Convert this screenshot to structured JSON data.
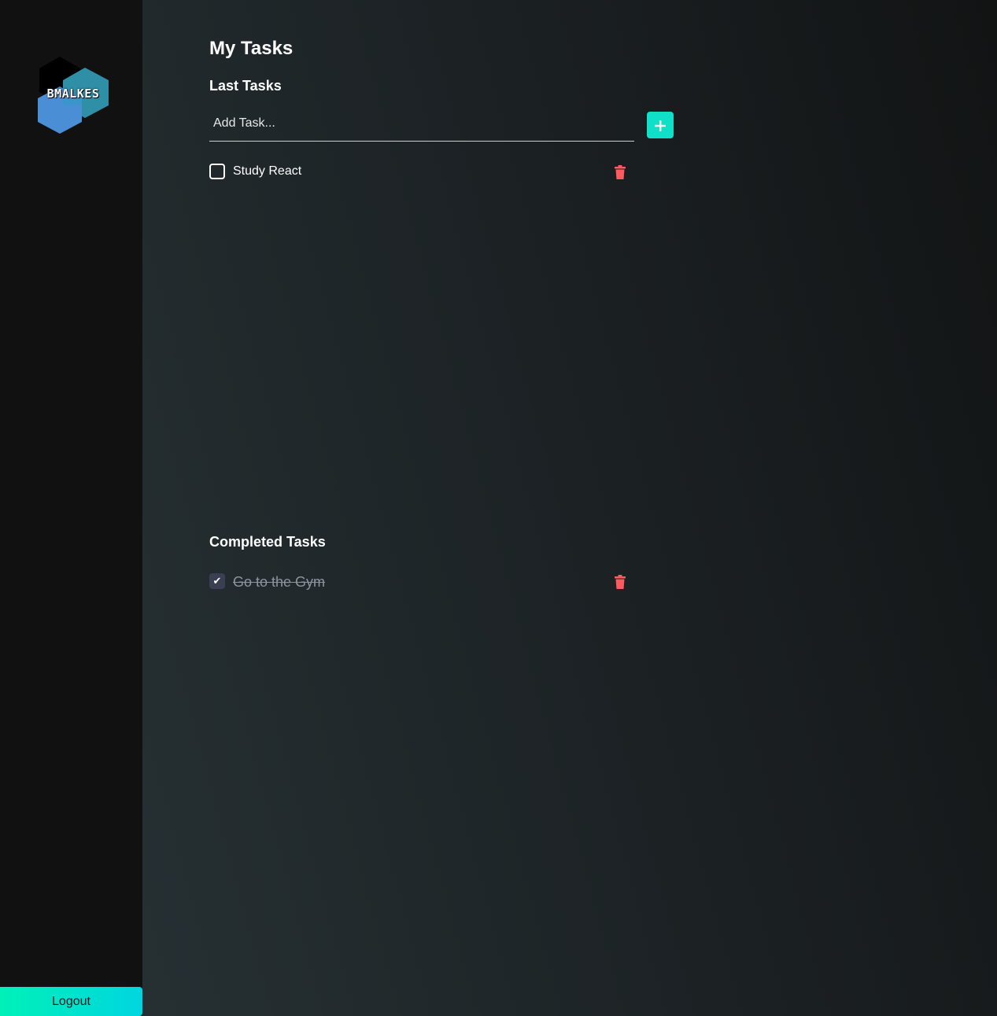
{
  "sidebar": {
    "logo_text": "BMALKES",
    "logout_label": "Logout"
  },
  "main": {
    "title": "My Tasks",
    "last_tasks_title": "Last Tasks",
    "add_task": {
      "placeholder": "Add Task...",
      "value": "",
      "add_icon": "plus-icon"
    },
    "pending_tasks": [
      {
        "label": "Study React",
        "checked": false
      }
    ],
    "completed_tasks_title": "Completed Tasks",
    "completed_tasks": [
      {
        "label": "Go to the Gym",
        "checked": true
      }
    ]
  },
  "colors": {
    "accent": "#11e0c8",
    "logout_gradient_start": "#00f0b8",
    "logout_gradient_end": "#00d6e0",
    "delete": "#ff5a5f",
    "sidebar_bg": "#111111"
  },
  "icons": {
    "delete": "trash-icon",
    "checked": "checkmark-icon"
  }
}
